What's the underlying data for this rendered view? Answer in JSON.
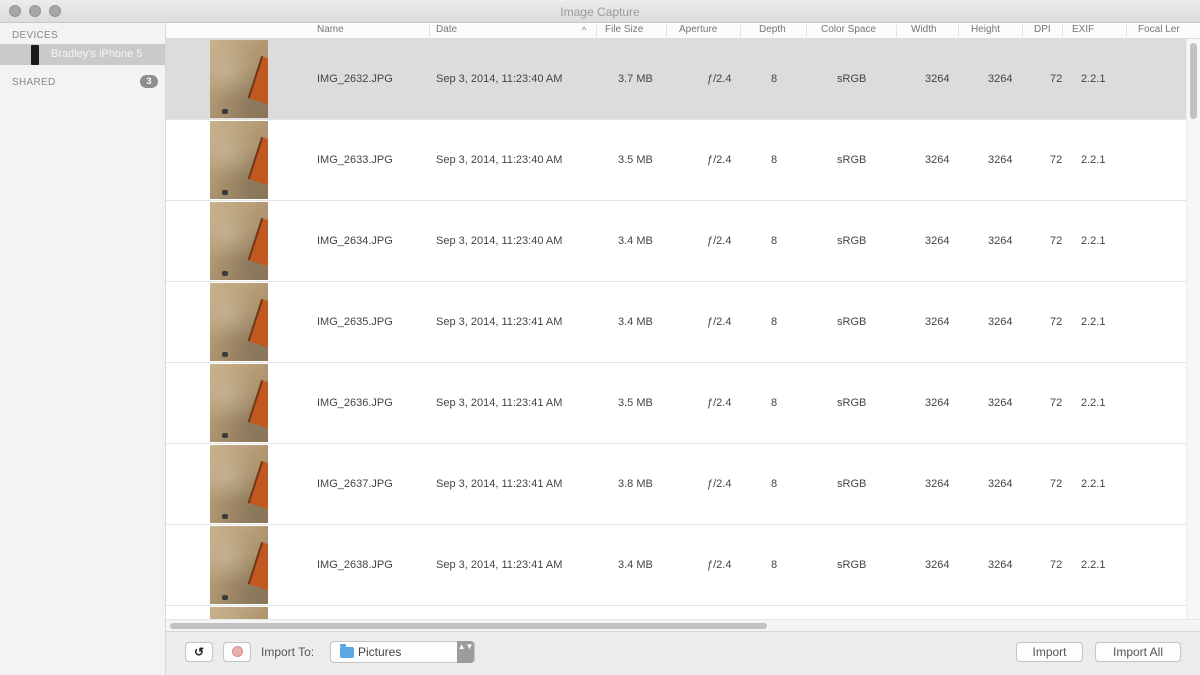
{
  "window": {
    "title": "Image Capture"
  },
  "sidebar": {
    "devices_heading": "DEVICES",
    "device_name": "Bradley's iPhone 5",
    "shared_heading": "SHARED",
    "shared_count": "3"
  },
  "columns": {
    "name": "Name",
    "date": "Date",
    "file_size": "File Size",
    "aperture": "Aperture",
    "depth": "Depth",
    "color_space": "Color Space",
    "width": "Width",
    "height": "Height",
    "dpi": "DPI",
    "exif": "EXIF",
    "focal": "Focal Ler"
  },
  "rows": [
    {
      "name": "IMG_2632.JPG",
      "date": "Sep 3, 2014, 11:23:40 AM",
      "size": "3.7 MB",
      "aperture": "ƒ/2.4",
      "depth": "8",
      "color_space": "sRGB",
      "width": "3264",
      "height": "3264",
      "dpi": "72",
      "exif": "2.2.1",
      "selected": true
    },
    {
      "name": "IMG_2633.JPG",
      "date": "Sep 3, 2014, 11:23:40 AM",
      "size": "3.5 MB",
      "aperture": "ƒ/2.4",
      "depth": "8",
      "color_space": "sRGB",
      "width": "3264",
      "height": "3264",
      "dpi": "72",
      "exif": "2.2.1",
      "selected": false
    },
    {
      "name": "IMG_2634.JPG",
      "date": "Sep 3, 2014, 11:23:40 AM",
      "size": "3.4 MB",
      "aperture": "ƒ/2.4",
      "depth": "8",
      "color_space": "sRGB",
      "width": "3264",
      "height": "3264",
      "dpi": "72",
      "exif": "2.2.1",
      "selected": false
    },
    {
      "name": "IMG_2635.JPG",
      "date": "Sep 3, 2014, 11:23:41 AM",
      "size": "3.4 MB",
      "aperture": "ƒ/2.4",
      "depth": "8",
      "color_space": "sRGB",
      "width": "3264",
      "height": "3264",
      "dpi": "72",
      "exif": "2.2.1",
      "selected": false
    },
    {
      "name": "IMG_2636.JPG",
      "date": "Sep 3, 2014, 11:23:41 AM",
      "size": "3.5 MB",
      "aperture": "ƒ/2.4",
      "depth": "8",
      "color_space": "sRGB",
      "width": "3264",
      "height": "3264",
      "dpi": "72",
      "exif": "2.2.1",
      "selected": false
    },
    {
      "name": "IMG_2637.JPG",
      "date": "Sep 3, 2014, 11:23:41 AM",
      "size": "3.8 MB",
      "aperture": "ƒ/2.4",
      "depth": "8",
      "color_space": "sRGB",
      "width": "3264",
      "height": "3264",
      "dpi": "72",
      "exif": "2.2.1",
      "selected": false
    },
    {
      "name": "IMG_2638.JPG",
      "date": "Sep 3, 2014, 11:23:41 AM",
      "size": "3.4 MB",
      "aperture": "ƒ/2.4",
      "depth": "8",
      "color_space": "sRGB",
      "width": "3264",
      "height": "3264",
      "dpi": "72",
      "exif": "2.2.1",
      "selected": false
    },
    {
      "name": "",
      "date": "",
      "size": "",
      "aperture": "",
      "depth": "",
      "color_space": "",
      "width": "",
      "height": "",
      "dpi": "",
      "exif": "",
      "selected": false
    }
  ],
  "toolbar": {
    "import_to_label": "Import To:",
    "destination": "Pictures",
    "import_label": "Import",
    "import_all_label": "Import All",
    "rotate_glyph": "↺",
    "stepper_glyph": "▲▼"
  },
  "icons": {
    "device": "iphone-icon",
    "folder": "folder-icon",
    "rotate": "rotate-icon",
    "delete": "delete-icon"
  },
  "colors": {
    "selected_row": "#dcdcdc",
    "sidebar_selected": "#cacaca",
    "folder": "#5aa7e6"
  }
}
